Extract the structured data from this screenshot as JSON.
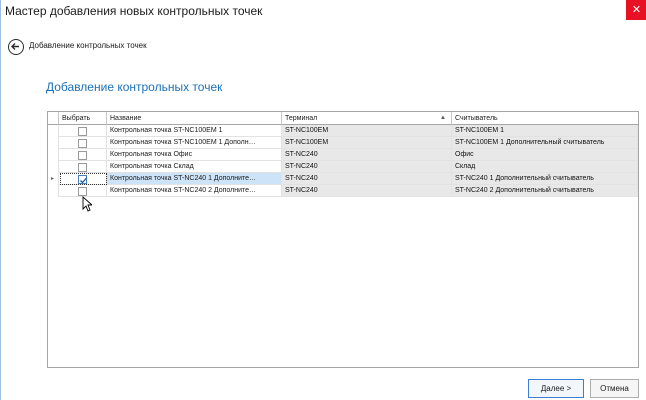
{
  "window": {
    "title": "Мастер добавления новых контрольных точек",
    "close_symbol": "✕"
  },
  "nav": {
    "back_icon": "arrow-left-circle-icon",
    "label": "Добавление контрольных точек"
  },
  "heading": "Добавление контрольных точек",
  "grid": {
    "columns": [
      {
        "label": "Выбрать"
      },
      {
        "label": "Название"
      },
      {
        "label": "Терминал",
        "sort": "ascending"
      },
      {
        "label": "Считыватель"
      }
    ],
    "rows": [
      {
        "checked": false,
        "name": "Контрольная точка ST-NC100EM 1",
        "terminal": "ST-NC100EM",
        "reader": "ST-NC100EM 1",
        "current": false
      },
      {
        "checked": false,
        "name": "Контрольная точка ST-NC100EM 1 Дополн…",
        "terminal": "ST-NC100EM",
        "reader": "ST-NC100EM 1 Дополнительный считыватель",
        "current": false
      },
      {
        "checked": false,
        "name": "Контрольная точка Офис",
        "terminal": "ST-NC240",
        "reader": "Офис",
        "current": false
      },
      {
        "checked": false,
        "name": "Контрольная точка Склад",
        "terminal": "ST-NC240",
        "reader": "Склад",
        "current": false
      },
      {
        "checked": true,
        "name": "Контрольная точка ST-NC240 1 Дополните…",
        "terminal": "ST-NC240",
        "reader": "ST-NC240 1 Дополнительный считыватель",
        "current": true
      },
      {
        "checked": false,
        "name": "Контрольная точка ST-NC240 2 Дополните…",
        "terminal": "ST-NC240",
        "reader": "ST-NC240 2 Дополнительный считыватель",
        "current": false
      }
    ],
    "current_row_indicator": "▸"
  },
  "buttons": {
    "next": "Далее >",
    "cancel": "Отмена"
  },
  "colors": {
    "accent": "#1e70b5",
    "close_bg": "#e81123",
    "selected_row": "#cde3f7",
    "readonly_cell": "#e8e8e8"
  }
}
